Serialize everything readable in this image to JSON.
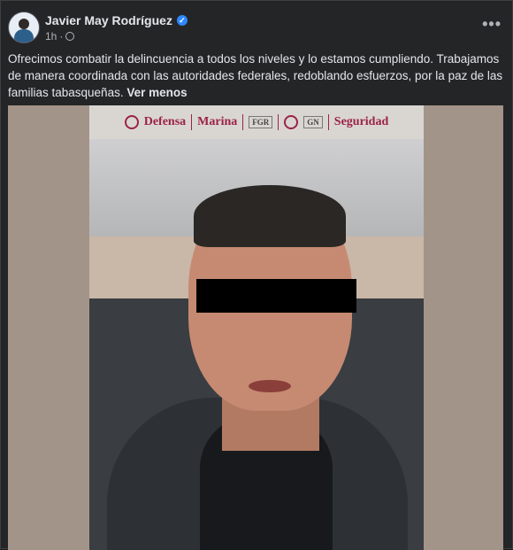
{
  "post": {
    "author": "Javier May Rodríguez",
    "time": "1h",
    "visibility_icon": "globe-icon",
    "menu_label": "•••",
    "text": "Ofrecimos combatir la delincuencia a todos los niveles y lo estamos cumpliendo.  Trabajamos de manera coordinada con las autoridades federales, redoblando esfuerzos,  por la paz de las familias tabasqueñas.",
    "see_less": "Ver menos"
  },
  "image": {
    "logos": [
      "Defensa",
      "Marina",
      "FGR",
      "GN",
      "Seguridad"
    ]
  },
  "colors": {
    "background": "#242526",
    "text": "#e4e6eb",
    "secondary_text": "#b0b3b8",
    "verified": "#2d88ff",
    "logo_accent": "#9b2247"
  }
}
